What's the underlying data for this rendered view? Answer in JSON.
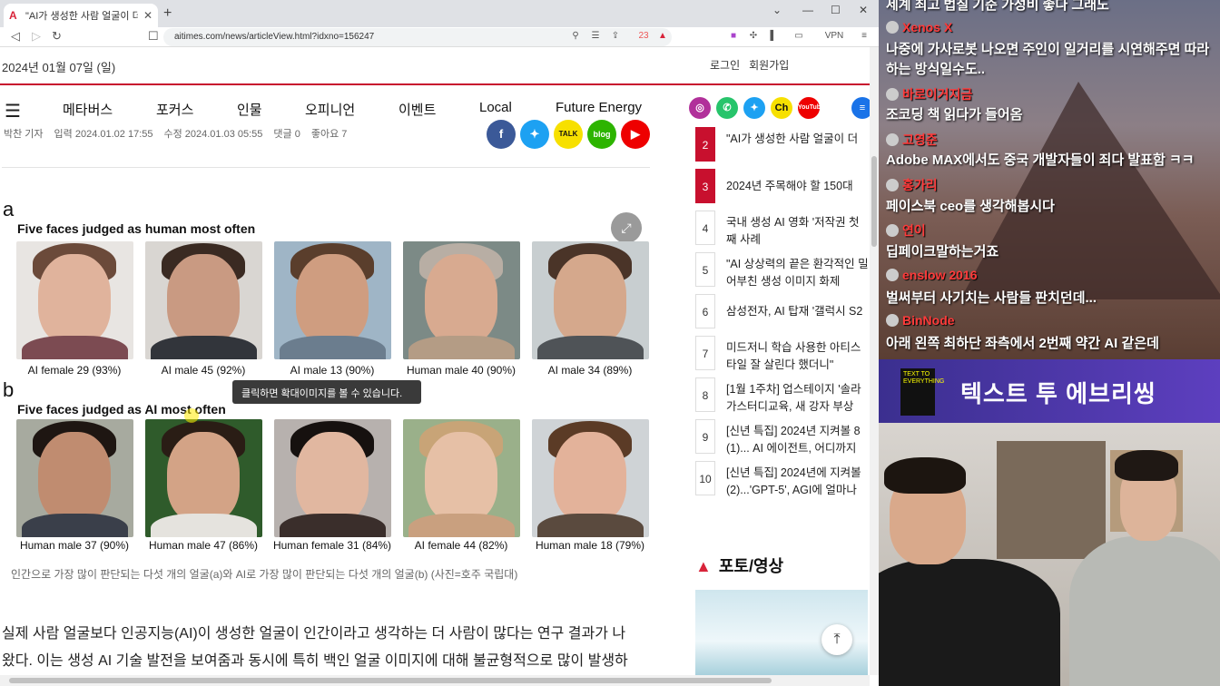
{
  "browser": {
    "tab_title": "\"AI가 생성한 사람 얼굴이 더 인간",
    "url": "aitimes.com/news/articleView.html?idxno=156247",
    "vpn": "VPN",
    "ext_badge": "23"
  },
  "header": {
    "date": "2024년 01월 07일 (일)",
    "login": "로그인",
    "signup": "회원가입"
  },
  "menu": [
    "메타버스",
    "포커스",
    "인물",
    "오피니언",
    "이벤트",
    "Local",
    "Future Energy"
  ],
  "social_top": {
    "instagram": "instagram-icon",
    "talk": "talk-icon",
    "twitter": "twitter-icon",
    "kakao_channel": "Ch",
    "youtube": "YouTube"
  },
  "meta": {
    "author": "박찬 기자",
    "input": "입력 2024.01.02 17:55",
    "edit": "수정 2024.01.03 05:55",
    "comments": "댓글 0",
    "likes": "좋아요 7"
  },
  "share": {
    "kakaotalk": "TALK",
    "blog": "blog"
  },
  "figure": {
    "panel_a": "a",
    "title_a": "Five faces judged as human most often",
    "panel_b": "b",
    "title_b": "Five faces judged as AI most often",
    "row_a": [
      "AI female 29 (93%)",
      "AI male 45 (92%)",
      "AI male 13 (90%)",
      "Human male 40 (90%)",
      "AI male 34 (89%)"
    ],
    "row_b": [
      "Human male 37 (90%)",
      "Human male 47 (86%)",
      "Human female 31 (84%)",
      "AI female 44 (82%)",
      "Human male 18 (79%)"
    ],
    "tooltip": "클릭하면 확대이미지를 볼 수 있습니다."
  },
  "caption": "인간으로 가장 많이 판단되는 다섯 개의 얼굴(a)와 AI로 가장 많이 판단되는 다섯 개의 얼굴(b) (사진=호주 국립대)",
  "body": [
    "실제 사람 얼굴보다 인공지능(AI)이 생성한 얼굴이 인간이라고 생각하는 더 사람이 많다는 연구 결과가 나",
    "왔다. 이는 생성 AI 기술 발전을 보여줌과 동시에 특히 백인 얼굴 이미지에 대해 불균형적으로 많이 발생하"
  ],
  "ranking": [
    {
      "n": "2",
      "t": "\"AI가 생성한 사람 얼굴이 더"
    },
    {
      "n": "3",
      "t": "2024년 주목해야 할 150대"
    },
    {
      "n": "4",
      "t": "국내 생성 AI 영화 '저작권 첫 째 사례"
    },
    {
      "n": "5",
      "t": "\"AI 상상력의 끝은 환각적인 밀어부친 생성 이미지 화제"
    },
    {
      "n": "6",
      "t": "삼성전자, AI 탑재 '갤럭시 S2"
    },
    {
      "n": "7",
      "t": "미드저니 학습 사용한 아티스 타일 잘 살린다 했더니\""
    },
    {
      "n": "8",
      "t": "[1월 1주차] 업스테이지 '솔라 가스터디교육, 새 강자 부상"
    },
    {
      "n": "9",
      "t": "[신년 특집] 2024년 지켜볼 8 (1)... AI 에이전트, 어디까지"
    },
    {
      "n": "10",
      "t": "[신년 특집] 2024년에 지켜볼 (2)...'GPT-5', AGI에 얼마나 가"
    }
  ],
  "photo_section": "포토/영상",
  "chat": {
    "top": "세계 최고 법칠 기준 가성비 좋다 그래도",
    "messages": [
      {
        "user": "Xenos X",
        "text": "나중에 가사로봇 나오면 주인이 일거리를 시연해주면 따라하는 방식일수도.."
      },
      {
        "user": "바로이거지금",
        "text": "조코딩 책 읽다가 들어옴"
      },
      {
        "user": "고영준",
        "text": "Adobe MAX에서도 중국 개발자들이 죄다 발표함 ㅋㅋ"
      },
      {
        "user": "홍가리",
        "text": "페이스북 ceo를 생각해봅시다"
      },
      {
        "user": "연이",
        "text": "딥페이크말하는거죠"
      },
      {
        "user": "enslow 2016",
        "text": "벌써부터 사기치는 사람들 판치던데..."
      },
      {
        "user": "BinNode",
        "text": "아래 왼쪽 최하단 좌측에서 2번째 약간 AI 같은데"
      }
    ]
  },
  "banner": {
    "title": "텍스트 투 에브리씽",
    "book": "TEXT TO EVERYTHING"
  }
}
